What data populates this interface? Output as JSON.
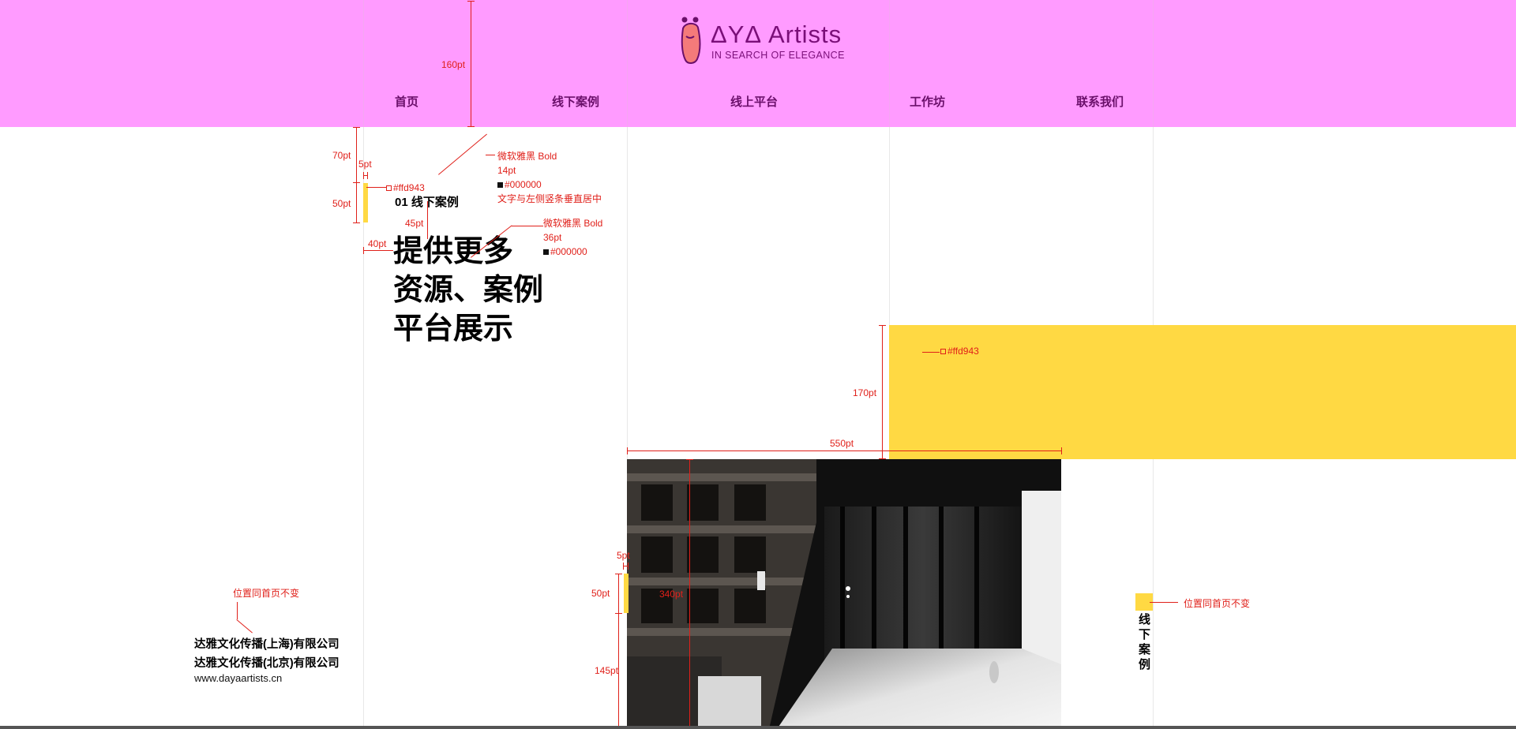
{
  "brand": {
    "name": "ΔYΔ Artists",
    "tagline": "IN SEARCH OF ELEGANCE",
    "header_color": "#ff9bff",
    "accent_color": "#ffd943"
  },
  "nav": {
    "items": [
      "首页",
      "线下案例",
      "线上平台",
      "工作坊",
      "联系我们"
    ]
  },
  "section": {
    "label": "01    线下案例",
    "headline_lines": [
      "提供更多",
      "资源、案例",
      "平台展示"
    ]
  },
  "sidebar_tab": {
    "label": "线下案例"
  },
  "footer": {
    "company_sh": "达雅文化传播(上海)有限公司",
    "company_bj": "达雅文化传播(北京)有限公司",
    "website": "www.dayaartists.cn"
  },
  "annotations": {
    "header_height": "160pt",
    "top_gap": "70pt",
    "bar_width": "5pt",
    "bar_height": "50pt",
    "bar_color": "#ffd943",
    "label_font": "微软雅黑 Bold",
    "label_size": "14pt",
    "label_color": "#000000",
    "label_note": "文字与左侧竖条垂直居中",
    "headline_gap": "45pt",
    "left_offset": "40pt",
    "headline_font": "微软雅黑 Bold",
    "headline_size": "36pt",
    "headline_color": "#000000",
    "yellow_height": "170pt",
    "yellow_color": "#ffd943",
    "photo_width": "550pt",
    "photo_height": "340pt",
    "photo_bar_width": "5pt",
    "photo_bar_height": "50pt",
    "photo_bottom_gap": "145pt",
    "footer_note": "位置同首页不变",
    "side_note": "位置同首页不变"
  }
}
